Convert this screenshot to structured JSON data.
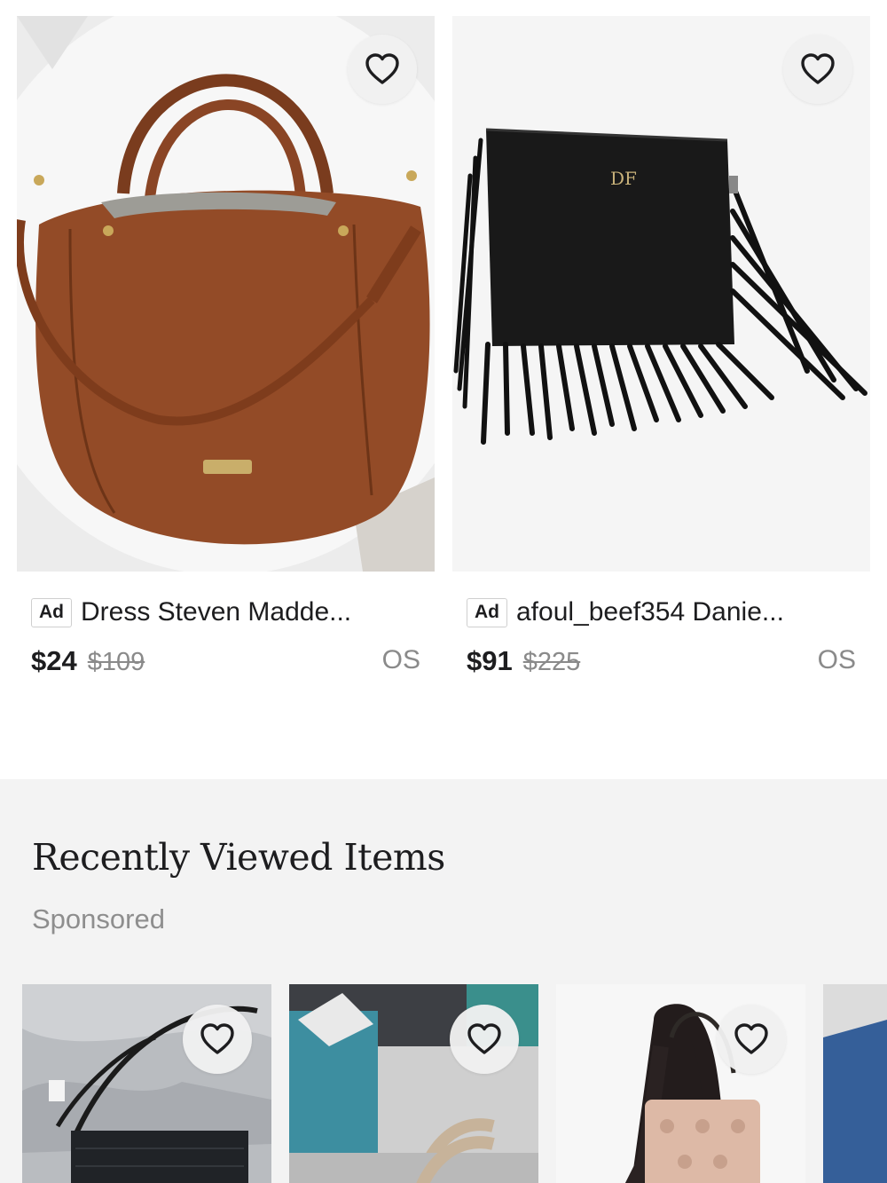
{
  "listings": [
    {
      "ad_label": "Ad",
      "title": "Dress Steven Madde...",
      "price": "$24",
      "original_price": "$109",
      "size": "OS",
      "image_icon": "brown-leather-hobo-bag",
      "heart_icon": "heart-outline-icon"
    },
    {
      "ad_label": "Ad",
      "title": "afoul_beef354 Danie...",
      "price": "$91",
      "original_price": "$225",
      "size": "OS",
      "image_icon": "black-fringe-clutch",
      "heart_icon": "heart-outline-icon"
    }
  ],
  "recently_viewed": {
    "title": "Recently Viewed Items",
    "subtitle": "Sponsored",
    "items": [
      {
        "image_icon": "black-crossbody-bag-on-fur"
      },
      {
        "image_icon": "tan-bag-strap-on-desk"
      },
      {
        "image_icon": "monogram-tote-on-model"
      },
      {
        "image_icon": "blue-item-partial"
      }
    ]
  },
  "colors": {
    "text": "#1d1d1f",
    "muted": "#8a8a8a",
    "section_bg": "#f3f3f3",
    "heart_bg": "#f0f0f0"
  }
}
